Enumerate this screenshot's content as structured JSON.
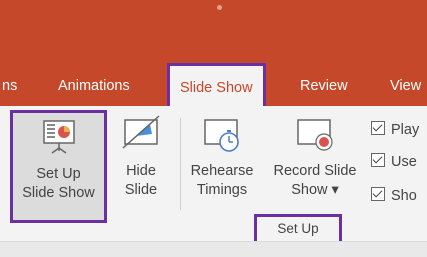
{
  "tabs": [
    {
      "label": "ns"
    },
    {
      "label": "Animations"
    },
    {
      "label": "Slide Show"
    },
    {
      "label": "Review"
    },
    {
      "label": "View"
    }
  ],
  "ribbon": {
    "setup_show": {
      "line1": "Set Up",
      "line2": "Slide Show"
    },
    "hide_slide": {
      "line1": "Hide",
      "line2": "Slide"
    },
    "rehearse": {
      "line1": "Rehearse",
      "line2": "Timings"
    },
    "record": {
      "line1": "Record Slide",
      "line2": "Show ▾"
    },
    "group_label": "Set Up",
    "checkboxes": [
      {
        "label": "Play"
      },
      {
        "label": "Use"
      },
      {
        "label": "Sho"
      }
    ]
  },
  "colors": {
    "accent": "#c6482a",
    "highlight": "#6a2fa0"
  }
}
